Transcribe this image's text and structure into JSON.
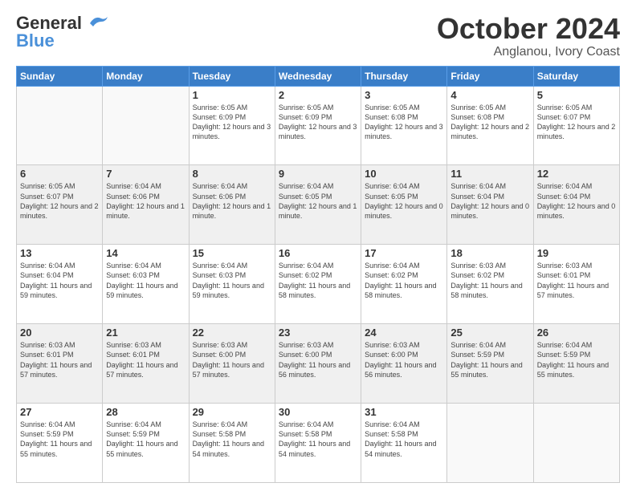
{
  "logo": {
    "line1": "General",
    "line2": "Blue"
  },
  "title": "October 2024",
  "subtitle": "Anglanou, Ivory Coast",
  "days_of_week": [
    "Sunday",
    "Monday",
    "Tuesday",
    "Wednesday",
    "Thursday",
    "Friday",
    "Saturday"
  ],
  "weeks": [
    [
      {
        "day": "",
        "info": ""
      },
      {
        "day": "",
        "info": ""
      },
      {
        "day": "1",
        "info": "Sunrise: 6:05 AM\nSunset: 6:09 PM\nDaylight: 12 hours and 3 minutes."
      },
      {
        "day": "2",
        "info": "Sunrise: 6:05 AM\nSunset: 6:09 PM\nDaylight: 12 hours and 3 minutes."
      },
      {
        "day": "3",
        "info": "Sunrise: 6:05 AM\nSunset: 6:08 PM\nDaylight: 12 hours and 3 minutes."
      },
      {
        "day": "4",
        "info": "Sunrise: 6:05 AM\nSunset: 6:08 PM\nDaylight: 12 hours and 2 minutes."
      },
      {
        "day": "5",
        "info": "Sunrise: 6:05 AM\nSunset: 6:07 PM\nDaylight: 12 hours and 2 minutes."
      }
    ],
    [
      {
        "day": "6",
        "info": "Sunrise: 6:05 AM\nSunset: 6:07 PM\nDaylight: 12 hours and 2 minutes."
      },
      {
        "day": "7",
        "info": "Sunrise: 6:04 AM\nSunset: 6:06 PM\nDaylight: 12 hours and 1 minute."
      },
      {
        "day": "8",
        "info": "Sunrise: 6:04 AM\nSunset: 6:06 PM\nDaylight: 12 hours and 1 minute."
      },
      {
        "day": "9",
        "info": "Sunrise: 6:04 AM\nSunset: 6:05 PM\nDaylight: 12 hours and 1 minute."
      },
      {
        "day": "10",
        "info": "Sunrise: 6:04 AM\nSunset: 6:05 PM\nDaylight: 12 hours and 0 minutes."
      },
      {
        "day": "11",
        "info": "Sunrise: 6:04 AM\nSunset: 6:04 PM\nDaylight: 12 hours and 0 minutes."
      },
      {
        "day": "12",
        "info": "Sunrise: 6:04 AM\nSunset: 6:04 PM\nDaylight: 12 hours and 0 minutes."
      }
    ],
    [
      {
        "day": "13",
        "info": "Sunrise: 6:04 AM\nSunset: 6:04 PM\nDaylight: 11 hours and 59 minutes."
      },
      {
        "day": "14",
        "info": "Sunrise: 6:04 AM\nSunset: 6:03 PM\nDaylight: 11 hours and 59 minutes."
      },
      {
        "day": "15",
        "info": "Sunrise: 6:04 AM\nSunset: 6:03 PM\nDaylight: 11 hours and 59 minutes."
      },
      {
        "day": "16",
        "info": "Sunrise: 6:04 AM\nSunset: 6:02 PM\nDaylight: 11 hours and 58 minutes."
      },
      {
        "day": "17",
        "info": "Sunrise: 6:04 AM\nSunset: 6:02 PM\nDaylight: 11 hours and 58 minutes."
      },
      {
        "day": "18",
        "info": "Sunrise: 6:03 AM\nSunset: 6:02 PM\nDaylight: 11 hours and 58 minutes."
      },
      {
        "day": "19",
        "info": "Sunrise: 6:03 AM\nSunset: 6:01 PM\nDaylight: 11 hours and 57 minutes."
      }
    ],
    [
      {
        "day": "20",
        "info": "Sunrise: 6:03 AM\nSunset: 6:01 PM\nDaylight: 11 hours and 57 minutes."
      },
      {
        "day": "21",
        "info": "Sunrise: 6:03 AM\nSunset: 6:01 PM\nDaylight: 11 hours and 57 minutes."
      },
      {
        "day": "22",
        "info": "Sunrise: 6:03 AM\nSunset: 6:00 PM\nDaylight: 11 hours and 57 minutes."
      },
      {
        "day": "23",
        "info": "Sunrise: 6:03 AM\nSunset: 6:00 PM\nDaylight: 11 hours and 56 minutes."
      },
      {
        "day": "24",
        "info": "Sunrise: 6:03 AM\nSunset: 6:00 PM\nDaylight: 11 hours and 56 minutes."
      },
      {
        "day": "25",
        "info": "Sunrise: 6:04 AM\nSunset: 5:59 PM\nDaylight: 11 hours and 55 minutes."
      },
      {
        "day": "26",
        "info": "Sunrise: 6:04 AM\nSunset: 5:59 PM\nDaylight: 11 hours and 55 minutes."
      }
    ],
    [
      {
        "day": "27",
        "info": "Sunrise: 6:04 AM\nSunset: 5:59 PM\nDaylight: 11 hours and 55 minutes."
      },
      {
        "day": "28",
        "info": "Sunrise: 6:04 AM\nSunset: 5:59 PM\nDaylight: 11 hours and 55 minutes."
      },
      {
        "day": "29",
        "info": "Sunrise: 6:04 AM\nSunset: 5:58 PM\nDaylight: 11 hours and 54 minutes."
      },
      {
        "day": "30",
        "info": "Sunrise: 6:04 AM\nSunset: 5:58 PM\nDaylight: 11 hours and 54 minutes."
      },
      {
        "day": "31",
        "info": "Sunrise: 6:04 AM\nSunset: 5:58 PM\nDaylight: 11 hours and 54 minutes."
      },
      {
        "day": "",
        "info": ""
      },
      {
        "day": "",
        "info": ""
      }
    ]
  ]
}
